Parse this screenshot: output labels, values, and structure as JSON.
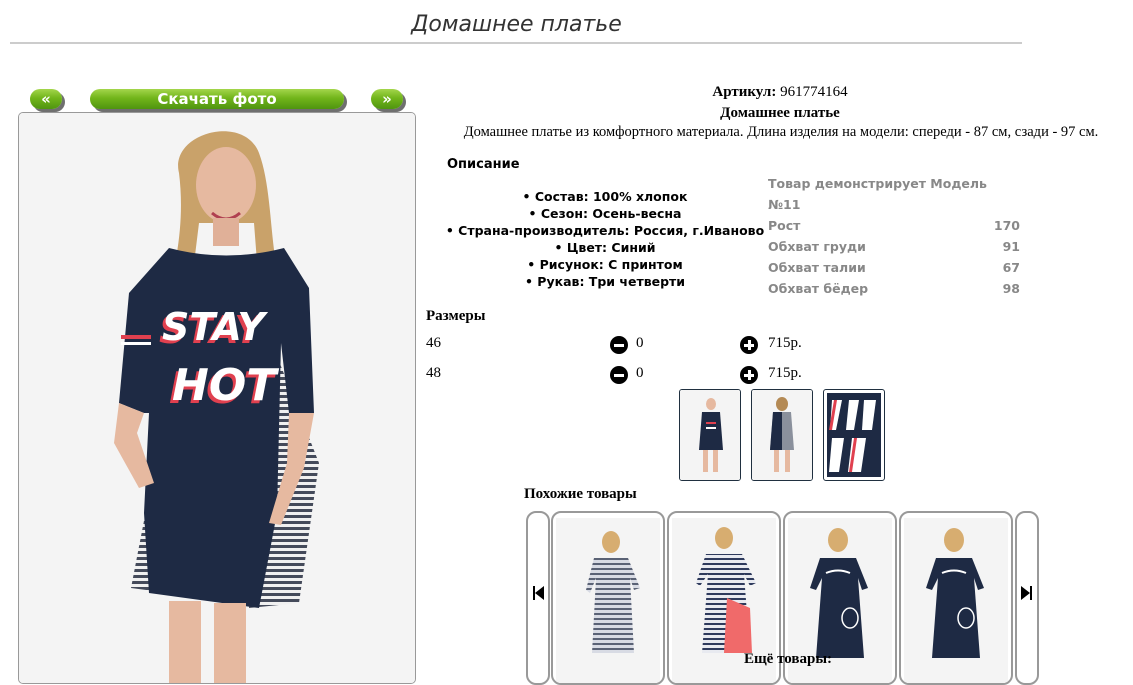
{
  "page": {
    "title": "Домашнее платье",
    "prev_label": "«",
    "download_label": "Скачать фото",
    "next_label": "»"
  },
  "product": {
    "article_label": "Артикул:",
    "article_value": "961774164",
    "name": "Домашнее платье",
    "description": "Домашнее платье из комфортного материала. Длина изделия на модели: спереди - 87 см, сзади - 97 см."
  },
  "specs": {
    "heading": "Описание",
    "items": [
      "• Состав: 100% хлопок",
      "• Сезон: Осень-весна",
      "• Страна-производитель: Россия, г.Иваново",
      "• Цвет: Синий",
      "• Рисунок: С принтом",
      "• Рукав: Три четверти"
    ]
  },
  "model": {
    "heading": "Товар демонстрирует Модель №11",
    "rows": [
      {
        "label": "Рост",
        "value": "170"
      },
      {
        "label": "Обхват груди",
        "value": "91"
      },
      {
        "label": "Обхват талии",
        "value": "67"
      },
      {
        "label": "Обхват бёдер",
        "value": "98"
      }
    ]
  },
  "sizes": {
    "heading": "Размеры",
    "rows": [
      {
        "size": "46",
        "qty": "0",
        "price": "715р."
      },
      {
        "size": "48",
        "qty": "0",
        "price": "715р."
      }
    ]
  },
  "similar": {
    "heading": "Похожие товары"
  },
  "more": {
    "heading": "Ещё товары:"
  },
  "colors": {
    "button_green": "#72b51b",
    "dress_navy": "#1e2a44",
    "print_red": "#e0404f",
    "muted_gray": "#888888"
  }
}
